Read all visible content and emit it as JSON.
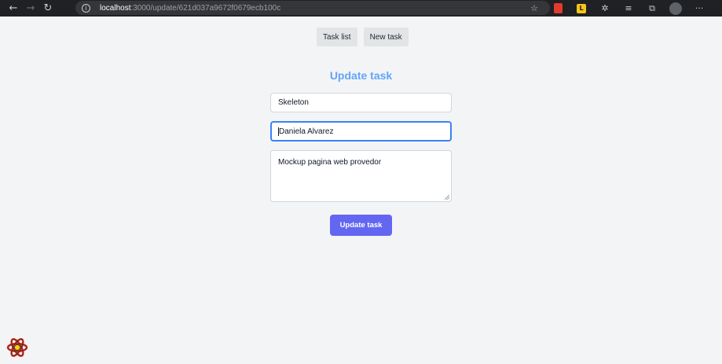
{
  "browser": {
    "url_host": "localhost",
    "url_path": ":3000/update/621d037a9672f0679ecb100c",
    "icons": [
      "back-arrow-icon",
      "forward-arrow-icon",
      "reload-icon",
      "site-info-icon",
      "favorites-add-icon",
      "extension-red-icon",
      "extension-l-icon",
      "extension-puzzle-icon",
      "favorites-icon",
      "collections-icon",
      "profile-avatar-icon",
      "more-icon"
    ],
    "ext_letter": "L"
  },
  "nav": {
    "task_list": "Task list",
    "new_task": "New task"
  },
  "form": {
    "heading": "Update task",
    "title_value": "Skeleton",
    "assignee_value": "Daniela Alvarez",
    "description_value": "Mockup pagina web provedor",
    "submit_label": "Update task"
  },
  "colors": {
    "heading": "#60a5fa",
    "submit_bg": "#6366f1",
    "focus_border": "#3b82f6",
    "page_bg": "#f3f4f6",
    "react_devtools_logo": "#e23a2f"
  }
}
